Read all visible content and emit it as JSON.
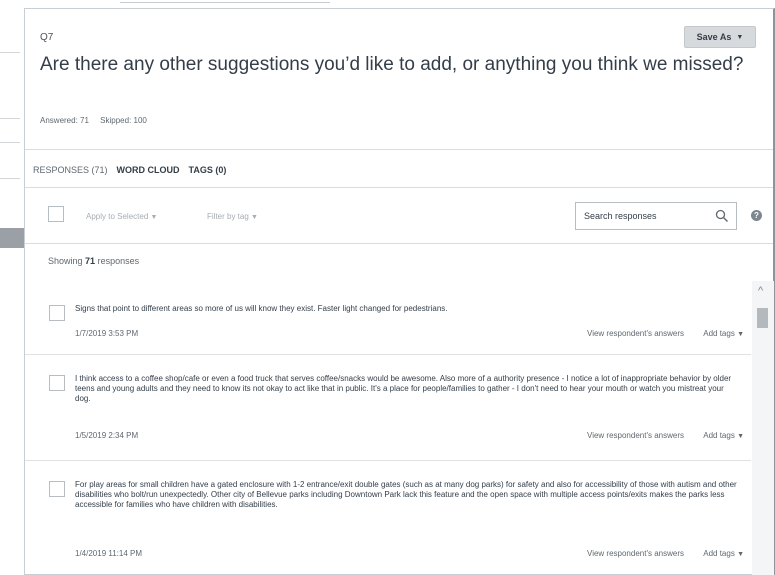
{
  "question": {
    "number": "Q7",
    "title": "Are there any other suggestions you’d like to add, or anything you think we missed?",
    "answered": "Answered: 71",
    "skipped": "Skipped: 100",
    "save_as_label": "Save As"
  },
  "tabs": [
    {
      "label": "RESPONSES (71)"
    },
    {
      "label": "WORD CLOUD"
    },
    {
      "label": "TAGS (0)"
    }
  ],
  "toolbar": {
    "apply_label": "Apply to Selected",
    "filter_label": "Filter by tag",
    "search_placeholder": "Search responses"
  },
  "showing": {
    "prefix": "Showing",
    "count": "71",
    "suffix": "responses"
  },
  "responses": [
    {
      "text": "Signs that point to different areas so more of us will know they exist. Faster light changed for pedestrians.",
      "date": "1/7/2019 3:53 PM",
      "view_label": "View respondent's answers",
      "tags_label": "Add tags"
    },
    {
      "text": "I think access to a coffee shop/cafe or even a food truck that serves coffee/snacks would be awesome. Also more of a authority presence - I notice a lot of inappropriate behavior by older teens and young adults and they need to know its not okay to act like that in public. It's a place for people/families to gather - I don't need to hear your mouth or watch you mistreat your dog.",
      "date": "1/5/2019 2:34 PM",
      "view_label": "View respondent's answers",
      "tags_label": "Add tags"
    },
    {
      "text": "For play areas for small children have a gated enclosure with 1-2 entrance/exit double gates (such as at many dog parks) for safety and also for accessibility of those with autism and other disabilities who bolt/run unexpectedly. Other city of Bellevue parks including Downtown Park lack this feature and the open space with multiple access points/exits makes the parks less accessible for families who have children with disabilities.",
      "date": "1/4/2019 11:14 PM",
      "view_label": "View respondent's answers",
      "tags_label": "Add tags"
    }
  ],
  "icons": {
    "search": "search-icon",
    "help": "help-icon",
    "caret": "caret-down-icon",
    "scroll_up": "chevron-up-icon"
  },
  "colors": {
    "text": "#333e48",
    "muted": "#5f6870",
    "button_bg": "#d7dadd",
    "border": "#c9ced3"
  }
}
